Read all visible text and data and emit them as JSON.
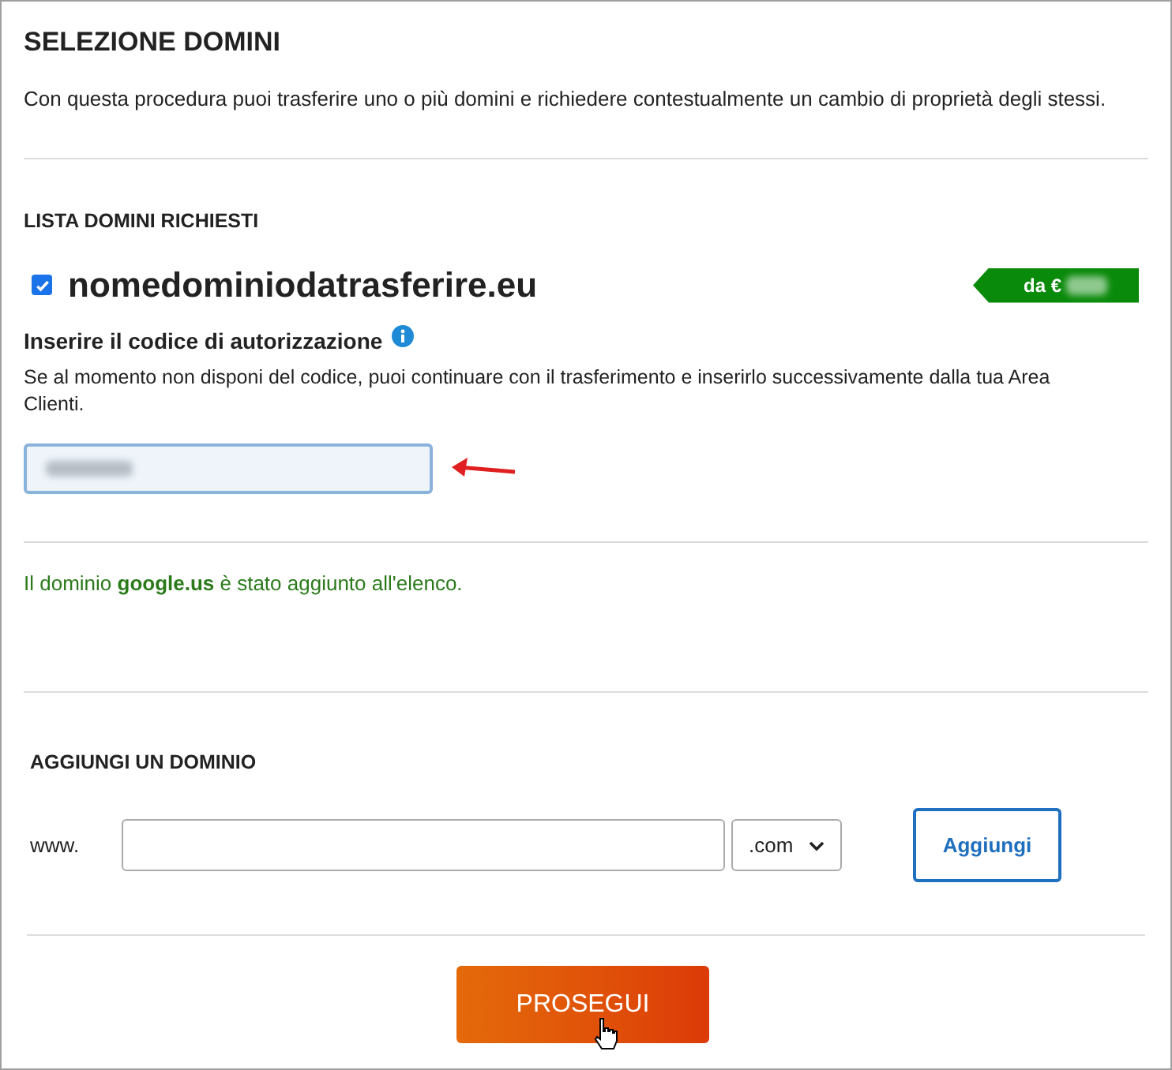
{
  "title": "SELEZIONE DOMINI",
  "intro": "Con questa procedura puoi trasferire uno o più domini e richiedere contestualmente un cambio di proprietà degli stessi.",
  "requested": {
    "heading": "LISTA DOMINI RICHIESTI",
    "domains": [
      {
        "name": "nomedominiodatrasferire.eu",
        "checked": true,
        "price_label": "da €",
        "auth_label": "Inserire il codice di autorizzazione",
        "auth_help": "Se al momento non disponi del codice, puoi continuare con il trasferimento e inserirlo successivamente dalla tua Area Clienti."
      }
    ]
  },
  "notice": "Il dominio **google.us** è stato aggiunto all'elenco.",
  "add_domain": {
    "heading": "AGGIUNGI UN DOMINIO",
    "prefix": "www.",
    "extension": ".com",
    "button": "Aggiungi"
  },
  "continue_button": "PROSEGUI"
}
